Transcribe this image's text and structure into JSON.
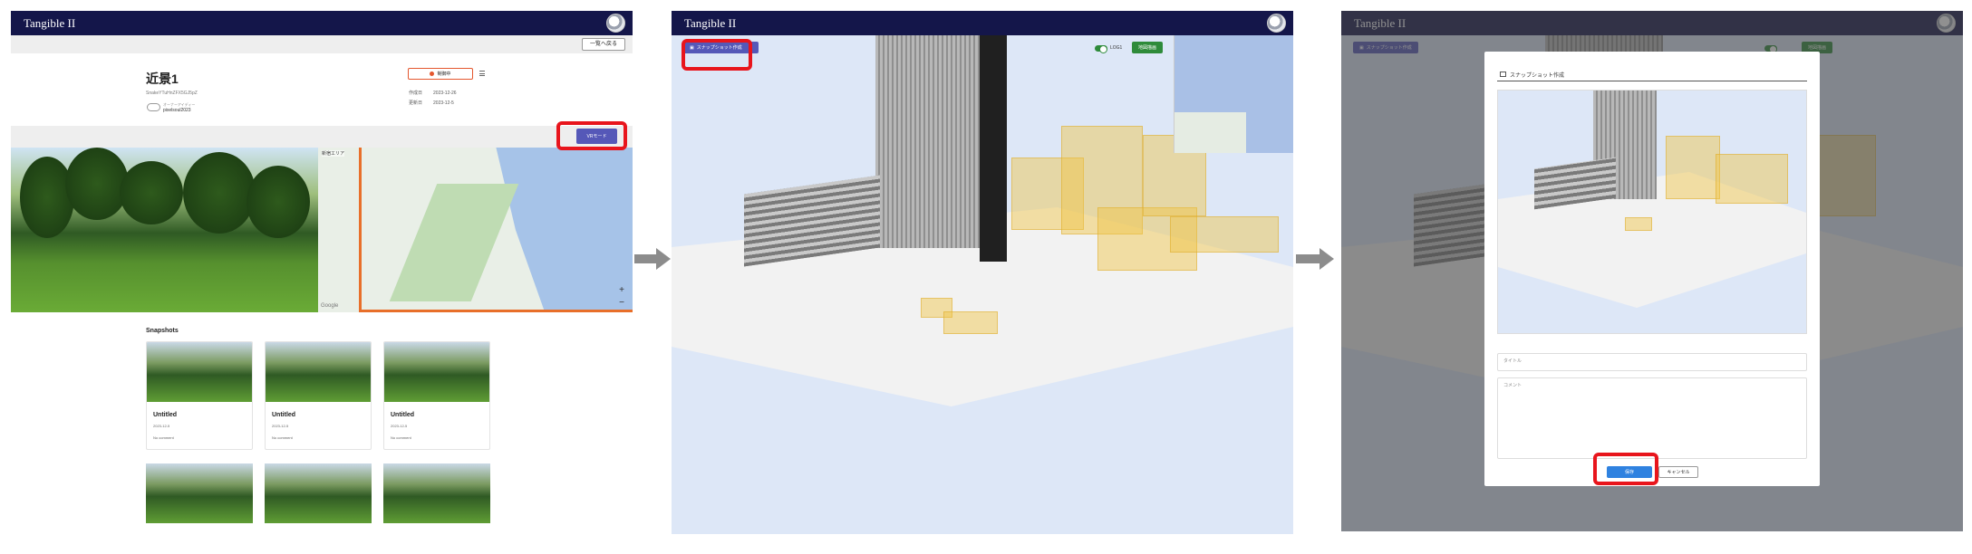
{
  "app": {
    "title": "Tangible II"
  },
  "step1": {
    "back_label": "一覧へ戻る",
    "scene_title": "近景1",
    "scene_id": "SnakeYTuHnZFX5GJ5pZ",
    "owner_label": "オーナーアイディー",
    "owner_name": "pixelsoul2023",
    "status_label": "制御中",
    "meta": [
      {
        "label": "作成日",
        "value": "2023-12-26"
      },
      {
        "label": "更新日",
        "value": "2023-12-5"
      }
    ],
    "vr_label": "VRモード",
    "map_area_label": "新宿エリア",
    "map_attribution": "Google",
    "snapshots_heading": "Snapshots",
    "cards": [
      {
        "title": "Untitled",
        "date": "2023-12-5",
        "comment": "No comment"
      },
      {
        "title": "Untitled",
        "date": "2023-12-5",
        "comment": "No comment"
      },
      {
        "title": "Untitled",
        "date": "2023-12-5",
        "comment": "No comment"
      }
    ]
  },
  "step2": {
    "snapshot_label": "スナップショット作成",
    "toggle_label": "LOG1",
    "map_button_label": "地図描画"
  },
  "step3": {
    "dialog_title": "スナップショット作成",
    "title_placeholder": "タイトル",
    "comment_placeholder": "コメント",
    "save_label": "保存",
    "cancel_label": "キャンセル"
  },
  "colors": {
    "nav": "#14164a",
    "primary": "#5558b8",
    "highlight": "#e8151c",
    "save": "#2f82e0",
    "map_green": "#2e8b3a"
  },
  "icons": [
    "avatar-icon",
    "menu-icon",
    "zoom-in-icon",
    "zoom-out-icon",
    "camera-icon",
    "arrow-right-icon"
  ]
}
